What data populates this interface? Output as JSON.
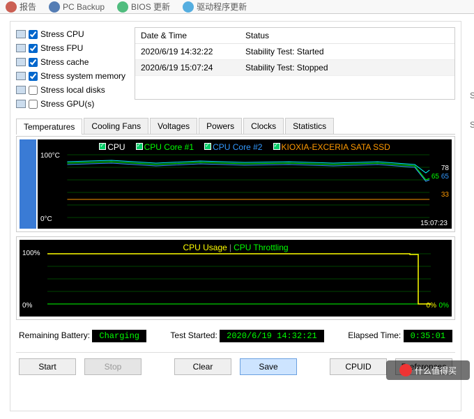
{
  "topbar": [
    {
      "label": "报告",
      "color": "#c0392b"
    },
    {
      "label": "PC Backup",
      "color": "#2d5fa4"
    },
    {
      "label": "BIOS 更新",
      "color": "#27ae60"
    },
    {
      "label": "驱动程序更新",
      "color": "#2d9cdb"
    }
  ],
  "stress": [
    {
      "label": "Stress CPU",
      "checked": true
    },
    {
      "label": "Stress FPU",
      "checked": true
    },
    {
      "label": "Stress cache",
      "checked": true
    },
    {
      "label": "Stress system memory",
      "checked": true
    },
    {
      "label": "Stress local disks",
      "checked": false
    },
    {
      "label": "Stress GPU(s)",
      "checked": false
    }
  ],
  "log": {
    "header_dt": "Date & Time",
    "header_st": "Status",
    "rows": [
      {
        "dt": "2020/6/19 14:32:22",
        "st": "Stability Test: Started"
      },
      {
        "dt": "2020/6/19 15:07:24",
        "st": "Stability Test: Stopped"
      }
    ]
  },
  "tabs": [
    "Temperatures",
    "Cooling Fans",
    "Voltages",
    "Powers",
    "Clocks",
    "Statistics"
  ],
  "active_tab": 0,
  "chart1": {
    "legend": [
      {
        "label": "CPU",
        "cls": "lc-cpu"
      },
      {
        "label": "CPU Core #1",
        "cls": "lc-c1"
      },
      {
        "label": "CPU Core #2",
        "cls": "lc-c2"
      },
      {
        "label": "KIOXIA-EXCERIA SATA SSD",
        "cls": "lc-ssd"
      }
    ],
    "y_top": "100°C",
    "y_bot": "0°C",
    "end_vals": [
      {
        "v": "78",
        "color": "#fff",
        "top": 36
      },
      {
        "v": "65",
        "color": "#39f",
        "top": 48
      },
      {
        "v": "65",
        "color": "#0f0",
        "top": 48,
        "dx": 14
      },
      {
        "v": "33",
        "color": "#f90",
        "top": 74
      }
    ],
    "time": "15:07:23"
  },
  "chart2": {
    "legend_usage": "CPU Usage",
    "legend_sep": "|",
    "legend_throt": "CPU Throttling",
    "y_top": "100%",
    "y_bot": "0%",
    "end_vals": [
      {
        "v": "0%",
        "color": "#ff0"
      },
      {
        "v": "0%",
        "color": "#0f0"
      }
    ]
  },
  "status": {
    "battery_lbl": "Remaining Battery:",
    "battery_val": "Charging",
    "started_lbl": "Test Started:",
    "started_val": "2020/6/19 14:32:21",
    "elapsed_lbl": "Elapsed Time:",
    "elapsed_val": "0:35:01"
  },
  "buttons": {
    "start": "Start",
    "stop": "Stop",
    "clear": "Clear",
    "save": "Save",
    "cpuid": "CPUID",
    "prefs": "Preferences"
  },
  "watermark": "什么值得买",
  "chart_data": [
    {
      "type": "line",
      "title": "Temperatures",
      "ylabel": "°C",
      "ylim": [
        0,
        100
      ],
      "x_end_time": "15:07:23",
      "series": [
        {
          "name": "CPU",
          "approx_range": [
            78,
            85
          ],
          "end_value": 78
        },
        {
          "name": "CPU Core #1",
          "approx_range": [
            65,
            85
          ],
          "end_value": 65
        },
        {
          "name": "CPU Core #2",
          "approx_range": [
            65,
            85
          ],
          "end_value": 65
        },
        {
          "name": "KIOXIA-EXCERIA SATA SSD",
          "approx_range": [
            33,
            33
          ],
          "end_value": 33
        }
      ]
    },
    {
      "type": "line",
      "title": "CPU Usage / Throttling",
      "ylabel": "%",
      "ylim": [
        0,
        100
      ],
      "series": [
        {
          "name": "CPU Usage",
          "approx_value": 100,
          "end_value": 0
        },
        {
          "name": "CPU Throttling",
          "approx_value": 0,
          "end_value": 0
        }
      ]
    }
  ]
}
